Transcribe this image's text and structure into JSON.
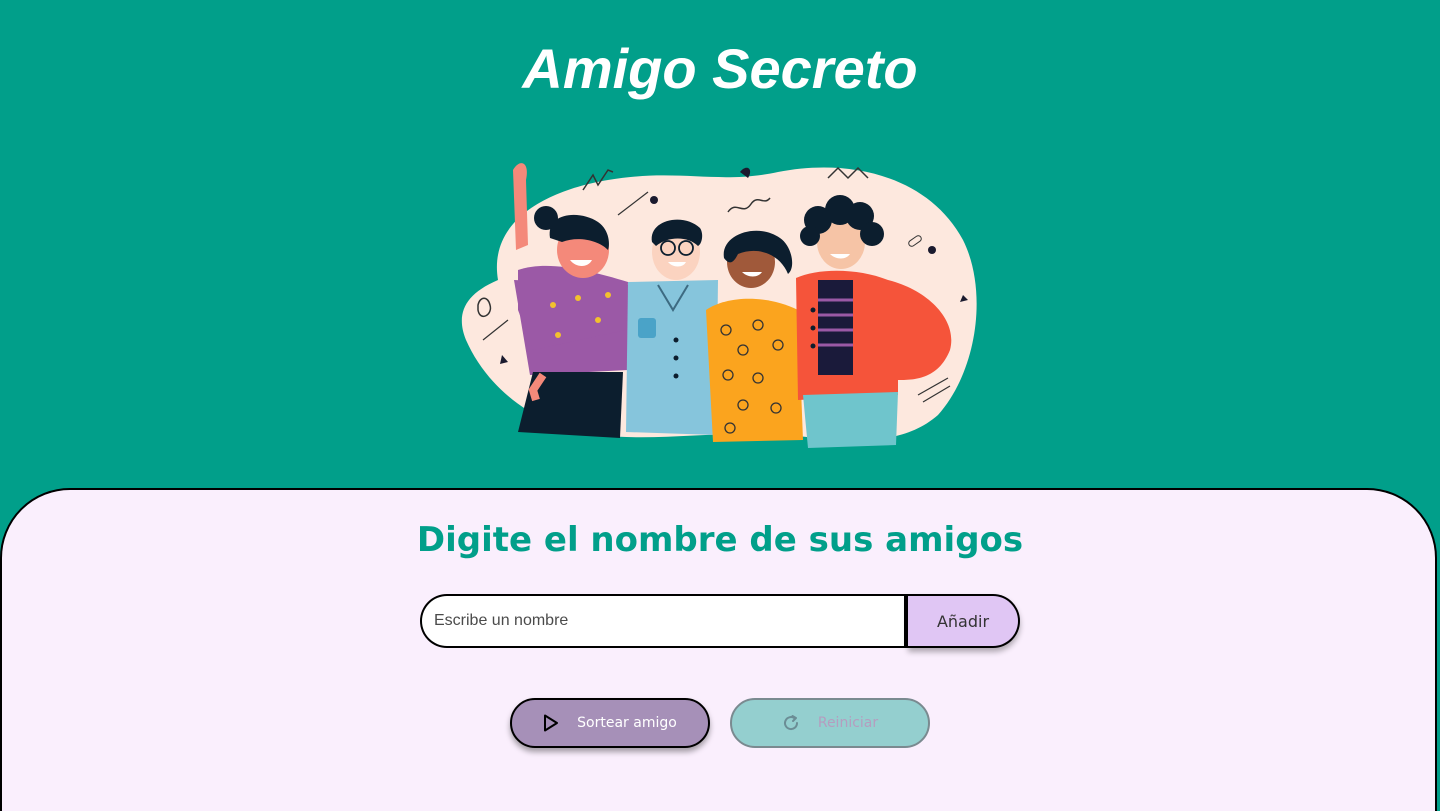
{
  "header": {
    "title": "Amigo Secreto",
    "illustration_icon": "group-of-friends-illustration"
  },
  "main": {
    "subtitle": "Digite el nombre de sus amigos",
    "name_input": {
      "placeholder": "Escribe un nombre",
      "value": ""
    },
    "add_label": "Añadir",
    "draw_label": "Sortear amigo",
    "draw_icon": "play-icon",
    "reset_label": "Reiniciar",
    "reset_icon": "refresh-icon"
  },
  "colors": {
    "header_bg": "#019f8a",
    "panel_bg": "#faeffd",
    "accent": "#019f8a",
    "add_button": "#e0c6f4",
    "draw_button": "#a690b8",
    "reset_button": "#94cfcf"
  }
}
